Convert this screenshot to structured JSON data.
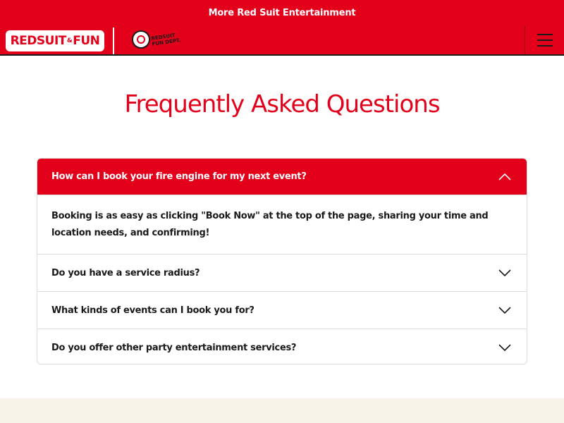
{
  "topbar": {
    "label": "More Red Suit Entertainment"
  },
  "header": {
    "logo_left": "REDSUIT",
    "logo_amp": "&",
    "logo_right": "FUN",
    "badge_line1": "REDSUIT",
    "badge_line2": "FUN DEPT."
  },
  "page": {
    "title": "Frequently Asked Questions"
  },
  "faq": {
    "items": [
      {
        "question": "How can I book your fire engine for my next event?",
        "answer": "Booking is as easy as clicking \"Book Now\" at the top of the page, sharing your time and location needs, and confirming!",
        "open": true
      },
      {
        "question": "Do you have a service radius?",
        "open": false
      },
      {
        "question": "What kinds of events can I book you for?",
        "open": false
      },
      {
        "question": "Do you offer other party entertainment services?",
        "open": false
      }
    ]
  },
  "colors": {
    "brand_red": "#e2001a",
    "footer_cream": "#f8f3e8",
    "text_dark": "#1a1a1a"
  }
}
